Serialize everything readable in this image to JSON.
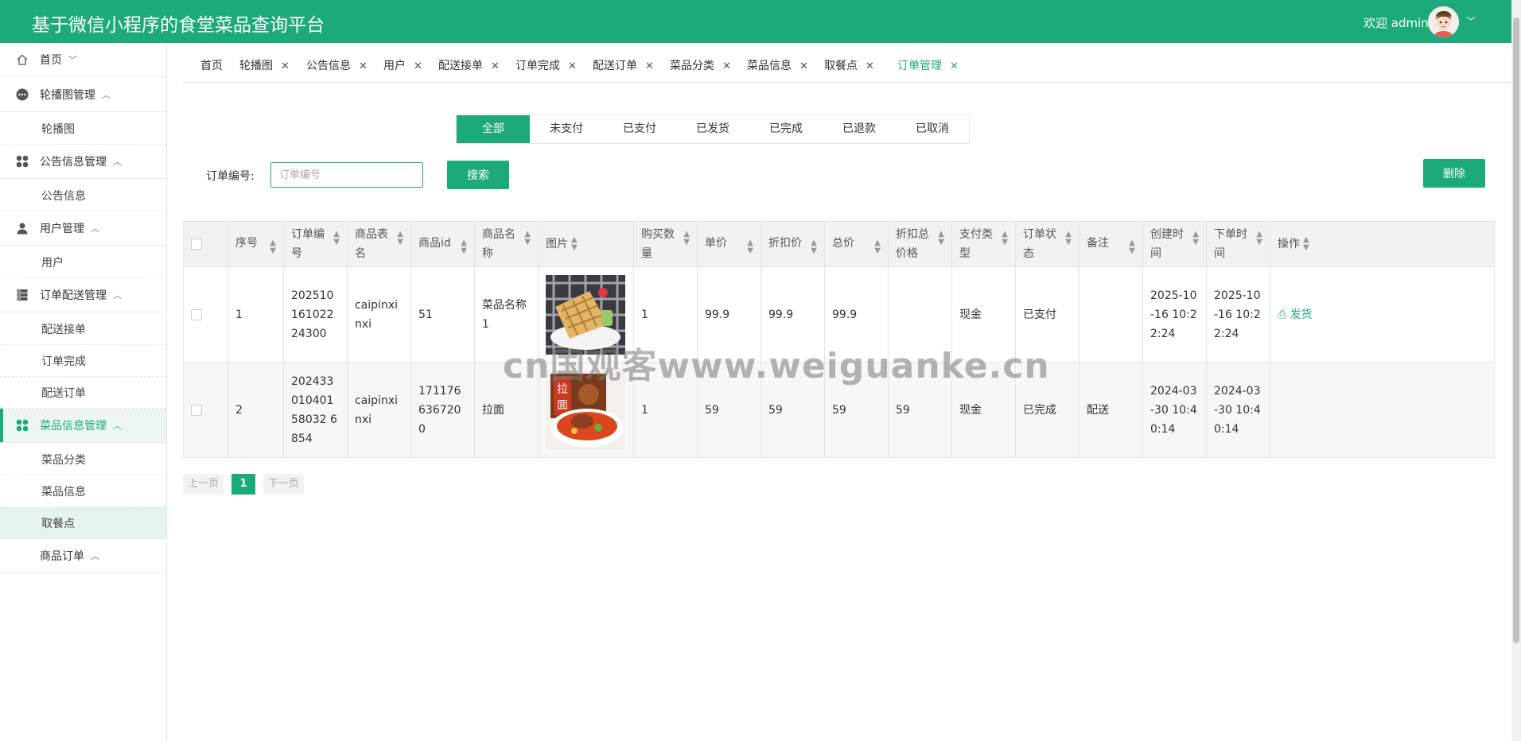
{
  "header": {
    "title": "基于微信小程序的食堂菜品查询平台",
    "welcome": "欢迎 admin"
  },
  "sidebar": {
    "items": [
      {
        "type": "group",
        "label": "首页",
        "icon": "home-icon",
        "caret": "﹀"
      },
      {
        "type": "group",
        "label": "轮播图管理",
        "icon": "more-icon",
        "caret": "︿"
      },
      {
        "type": "sub",
        "label": "轮播图"
      },
      {
        "type": "group",
        "label": "公告信息管理",
        "icon": "grid-icon",
        "caret": "︿"
      },
      {
        "type": "sub",
        "label": "公告信息"
      },
      {
        "type": "group",
        "label": "用户管理",
        "icon": "user-icon",
        "caret": "︿"
      },
      {
        "type": "sub",
        "label": "用户"
      },
      {
        "type": "group",
        "label": "订单配送管理",
        "icon": "server-icon",
        "caret": "︿"
      },
      {
        "type": "sub",
        "label": "配送接单"
      },
      {
        "type": "sub",
        "label": "订单完成"
      },
      {
        "type": "sub",
        "label": "配送订单"
      },
      {
        "type": "group",
        "label": "菜品信息管理",
        "icon": "grid-icon",
        "caret": "︿",
        "active": true
      },
      {
        "type": "sub",
        "label": "菜品分类"
      },
      {
        "type": "sub",
        "label": "菜品信息"
      },
      {
        "type": "sub",
        "label": "取餐点",
        "selected": true
      },
      {
        "type": "group",
        "label": "商品订单",
        "icon": "",
        "caret": "︿"
      }
    ]
  },
  "tabs": [
    {
      "label": "首页",
      "closable": false
    },
    {
      "label": "轮播图",
      "closable": true
    },
    {
      "label": "公告信息",
      "closable": true
    },
    {
      "label": "用户",
      "closable": true
    },
    {
      "label": "配送接单",
      "closable": true
    },
    {
      "label": "订单完成",
      "closable": true
    },
    {
      "label": "配送订单",
      "closable": true
    },
    {
      "label": "菜品分类",
      "closable": true
    },
    {
      "label": "菜品信息",
      "closable": true
    },
    {
      "label": "取餐点",
      "closable": true
    },
    {
      "label": "订单管理",
      "closable": true,
      "active": true
    }
  ],
  "status_filter": {
    "options": [
      "全部",
      "未支付",
      "已支付",
      "已发货",
      "已完成",
      "已退款",
      "已取消"
    ],
    "selected": "全部"
  },
  "search": {
    "label": "订单编号:",
    "placeholder": "订单编号",
    "button": "搜索"
  },
  "delete_button": "删除",
  "table": {
    "columns": [
      "序号",
      "订单编号",
      "商品表名",
      "商品id",
      "商品名称",
      "图片",
      "购买数量",
      "单价",
      "折扣价",
      "总价",
      "折扣总价格",
      "支付类型",
      "订单状态",
      "备注",
      "创建时间",
      "下单时间",
      "操作"
    ],
    "rows": [
      {
        "index": "1",
        "order_no": "20251016102224300",
        "table_name": "caipinxinxi",
        "goods_id": "51",
        "goods_name": "菜品名称1",
        "image": "waffle",
        "qty": "1",
        "price": "99.9",
        "discount_price": "99.9",
        "total": "99.9",
        "discount_total": "",
        "pay_type": "现金",
        "status": "已支付",
        "remark": "",
        "created": "2025-10-16 10:22:24",
        "ordered": "2025-10-16 10:22:24",
        "action": "发货"
      },
      {
        "index": "2",
        "order_no": "20243301040158032 6854",
        "table_name": "caipinxinxi",
        "goods_id": "1711766367200",
        "goods_name": "拉面",
        "image": "ramen",
        "qty": "1",
        "price": "59",
        "discount_price": "59",
        "total": "59",
        "discount_total": "59",
        "pay_type": "现金",
        "status": "已完成",
        "remark": "配送",
        "created": "2024-03-30 10:40:14",
        "ordered": "2024-03-30 10:40:14",
        "action": ""
      }
    ]
  },
  "pagination": {
    "prev": "上一页",
    "current": "1",
    "next": "下一页"
  },
  "watermark": "cn国观客www.weiguanke.cn",
  "colors": {
    "primary": "#1daa7a"
  }
}
